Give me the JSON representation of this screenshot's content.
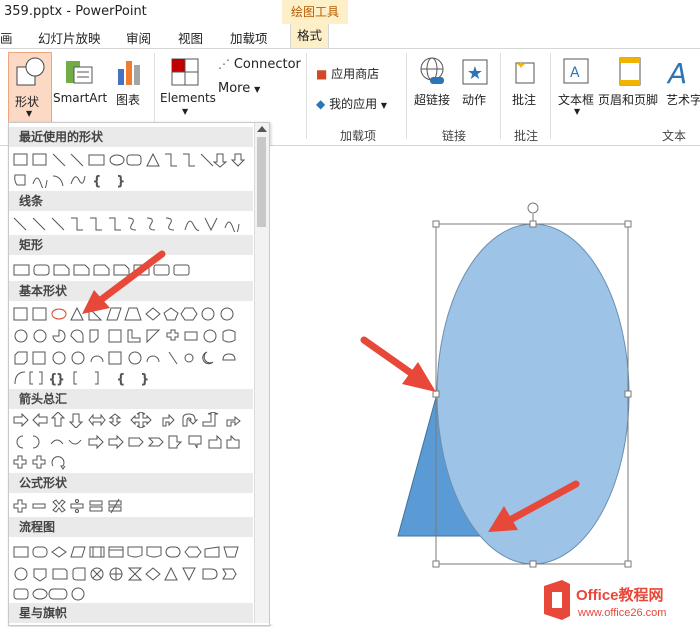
{
  "window": {
    "title": "359.pptx - PowerPoint",
    "context_tab": "绘图工具"
  },
  "tabs": [
    "画",
    "幻灯片放映",
    "审阅",
    "视图",
    "加载项",
    "格式"
  ],
  "ribbon": {
    "shape": "形状",
    "smartart": "SmartArt",
    "chart": "图表",
    "elements": "Elements",
    "connector": "Connector",
    "more": "More",
    "app_store": "应用商店",
    "my_apps": "我的应用",
    "addins_group": "加载项",
    "hyperlink": "超链接",
    "action": "动作",
    "links_group": "链接",
    "comment": "批注",
    "comment_group": "批注",
    "textbox": "文本框",
    "header_footer": "页眉和页脚",
    "wordart": "艺术字",
    "text_group": "文本"
  },
  "panel": {
    "categories": [
      "最近使用的形状",
      "线条",
      "矩形",
      "基本形状",
      "箭头总汇",
      "公式形状",
      "流程图",
      "星与旗帜"
    ]
  },
  "colors": {
    "ellipse": "#9dc3e6",
    "triangle": "#5b9bd5",
    "arrow": "#e8483a",
    "accent": "#d24726",
    "context_tab_bg": "#fdf0c8"
  },
  "watermark": {
    "name": "Office教程网",
    "url": "www.office26.com"
  }
}
